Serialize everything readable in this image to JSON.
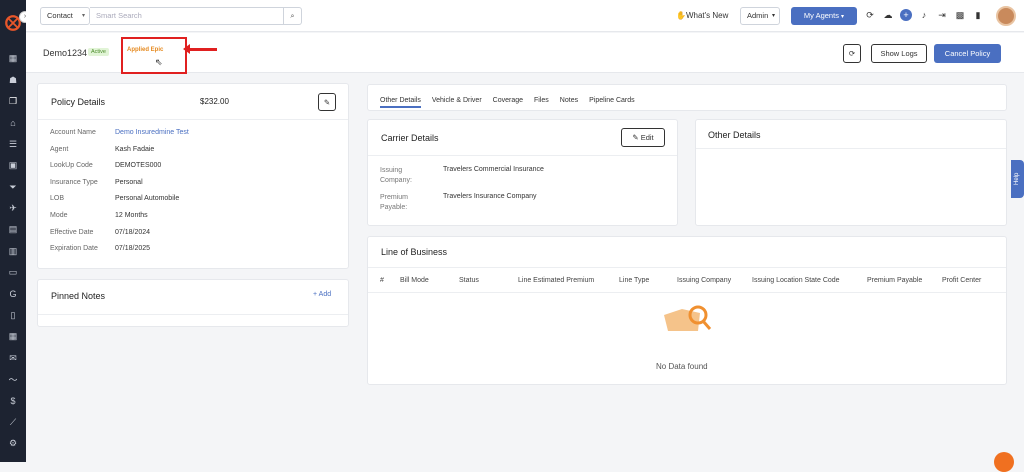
{
  "topbar": {
    "contact_select": "Contact",
    "search_placeholder": "Smart Search",
    "whats_new": "What's New",
    "admin_select": "Admin",
    "my_agents": "My Agents"
  },
  "policy": {
    "name": "Demo1234",
    "status": "Active",
    "applied_epic": "Applied Epic",
    "show_logs": "Show Logs",
    "cancel_policy": "Cancel Policy"
  },
  "policy_details": {
    "title": "Policy Details",
    "amount": "$232.00",
    "rows": [
      {
        "label": "Account Name",
        "value": "Demo Insuredmine Test",
        "link": true
      },
      {
        "label": "Agent",
        "value": "Kash Fadaie"
      },
      {
        "label": "LookUp Code",
        "value": "DEMOTES000"
      },
      {
        "label": "Insurance Type",
        "value": "Personal"
      },
      {
        "label": "LOB",
        "value": "Personal Automobile"
      },
      {
        "label": "Mode",
        "value": "12 Months"
      },
      {
        "label": "Effective Date",
        "value": "07/18/2024"
      },
      {
        "label": "Expiration Date",
        "value": "07/18/2025"
      }
    ]
  },
  "pinned_notes": {
    "title": "Pinned Notes",
    "add": "Add"
  },
  "tabs": [
    "Other Details",
    "Vehicle & Driver",
    "Coverage",
    "Files",
    "Notes",
    "Pipeline Cards"
  ],
  "carrier_details": {
    "title": "Carrier Details",
    "edit": "Edit",
    "issuing_label": "Issuing Company:",
    "issuing_value": "Travelers Commercial Insurance",
    "premium_label": "Premium Payable:",
    "premium_value": "Travelers Insurance Company"
  },
  "other_details": {
    "title": "Other Details"
  },
  "line_of_business": {
    "title": "Line of Business",
    "columns": [
      "#",
      "Bill Mode",
      "Status",
      "Line Estimated Premium",
      "Line Type",
      "Issuing Company",
      "Issuing Location State Code",
      "Premium Payable",
      "Profit Center"
    ],
    "empty": "No Data found"
  },
  "help": "Help",
  "colors": {
    "primary": "#4a6fc1",
    "sidebar": "#1d2331",
    "highlight": "#e02020",
    "active_badge": "#e1f4d6"
  }
}
